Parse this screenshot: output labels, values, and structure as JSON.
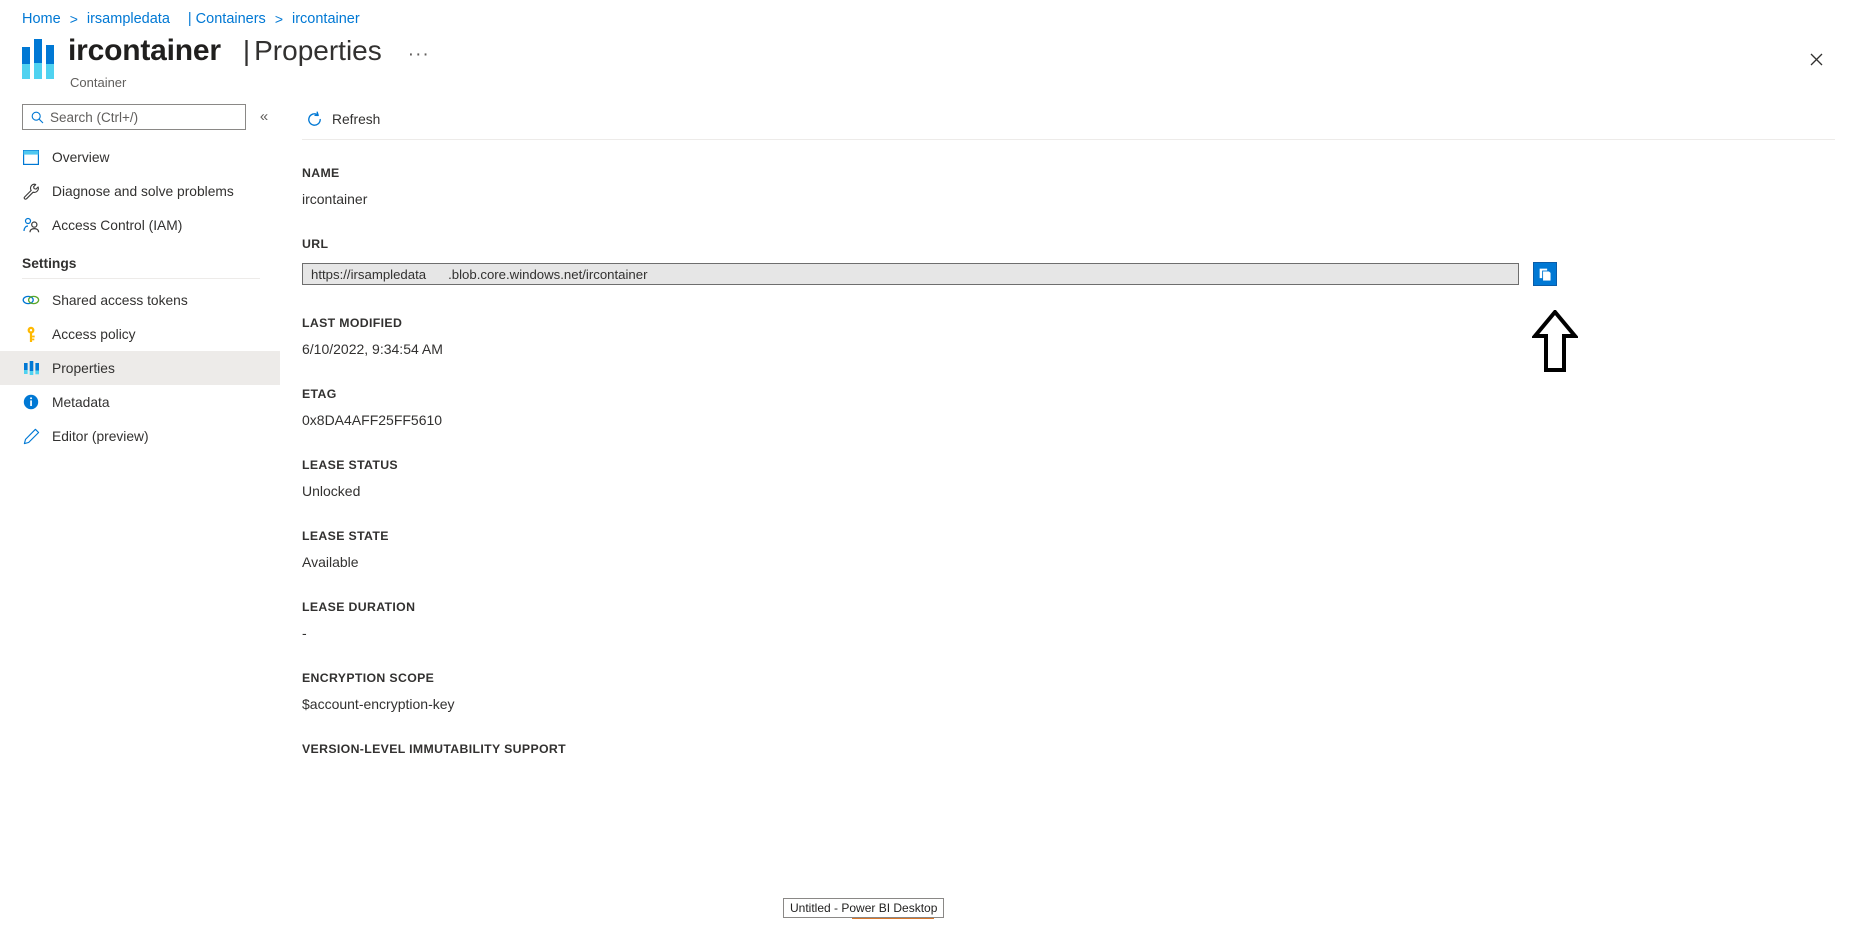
{
  "breadcrumb": {
    "items": [
      {
        "label": "Home",
        "sep": ">"
      },
      {
        "label": "irsampledata",
        "sep": ""
      },
      {
        "label": "| Containers",
        "sep": ">"
      },
      {
        "label": "ircontainer",
        "sep": ""
      }
    ],
    "home": "Home",
    "account": "irsampledata",
    "containers": "| Containers",
    "container": "ircontainer",
    "sep1": ">",
    "sep2": ">"
  },
  "header": {
    "title": "ircontainer",
    "divider": "|",
    "page": "Properties",
    "ellipsis": "···",
    "caption": "Container",
    "close": "✕",
    "icon": "bar-chart-icon"
  },
  "sidebar": {
    "search_placeholder": "Search (Ctrl+/)",
    "search_value": "",
    "collapse": "«",
    "items": [
      {
        "label": "Overview",
        "icon": "overview-icon",
        "selected": false
      },
      {
        "label": "Diagnose and solve problems",
        "icon": "wrench-icon",
        "selected": false
      },
      {
        "label": "Access Control (IAM)",
        "icon": "people-icon",
        "selected": false
      }
    ],
    "group_label": "Settings",
    "settings_items": [
      {
        "label": "Shared access tokens",
        "icon": "link-icon",
        "selected": false
      },
      {
        "label": "Access policy",
        "icon": "key-icon",
        "selected": false
      },
      {
        "label": "Properties",
        "icon": "bars-icon",
        "selected": true
      },
      {
        "label": "Metadata",
        "icon": "info-icon",
        "selected": false
      },
      {
        "label": "Editor (preview)",
        "icon": "pencil-icon",
        "selected": false
      }
    ]
  },
  "toolbar": {
    "refresh_label": "Refresh",
    "refresh_icon": "refresh-icon"
  },
  "properties": [
    {
      "label": "NAME",
      "value": "ircontainer",
      "type": "text"
    },
    {
      "label": "URL",
      "value": "",
      "type": "url"
    },
    {
      "label": "LAST MODIFIED",
      "value": "6/10/2022, 9:34:54 AM",
      "type": "text"
    },
    {
      "label": "ETAG",
      "value": "0x8DA4AFF25FF5610",
      "type": "text"
    },
    {
      "label": "LEASE STATUS",
      "value": "Unlocked",
      "type": "text"
    },
    {
      "label": "LEASE STATE",
      "value": "Available",
      "type": "text"
    },
    {
      "label": "LEASE DURATION",
      "value": "-",
      "type": "text"
    },
    {
      "label": "ENCRYPTION SCOPE",
      "value": "$account-encryption-key",
      "type": "text"
    },
    {
      "label": "VERSION-LEVEL IMMUTABILITY SUPPORT",
      "value": "",
      "type": "text"
    }
  ],
  "url_field": {
    "host": "https://irsampledata",
    "rest": ".blob.core.windows.net/ircontainer",
    "full": "https://irsampledata.blob.core.windows.net/ircontainer",
    "copy_icon": "copy-icon",
    "copy_title": "Copy to clipboard"
  },
  "annotation": {
    "arrow": "up-arrow-annotation"
  },
  "taskbar": {
    "tooltip": "Untitled - Power BI Desktop"
  },
  "colors": {
    "accent": "#0078d4",
    "link": "#0078d4",
    "selected_bg": "#edebe9",
    "field_bg": "#e6e6e6",
    "text": "#323130"
  }
}
